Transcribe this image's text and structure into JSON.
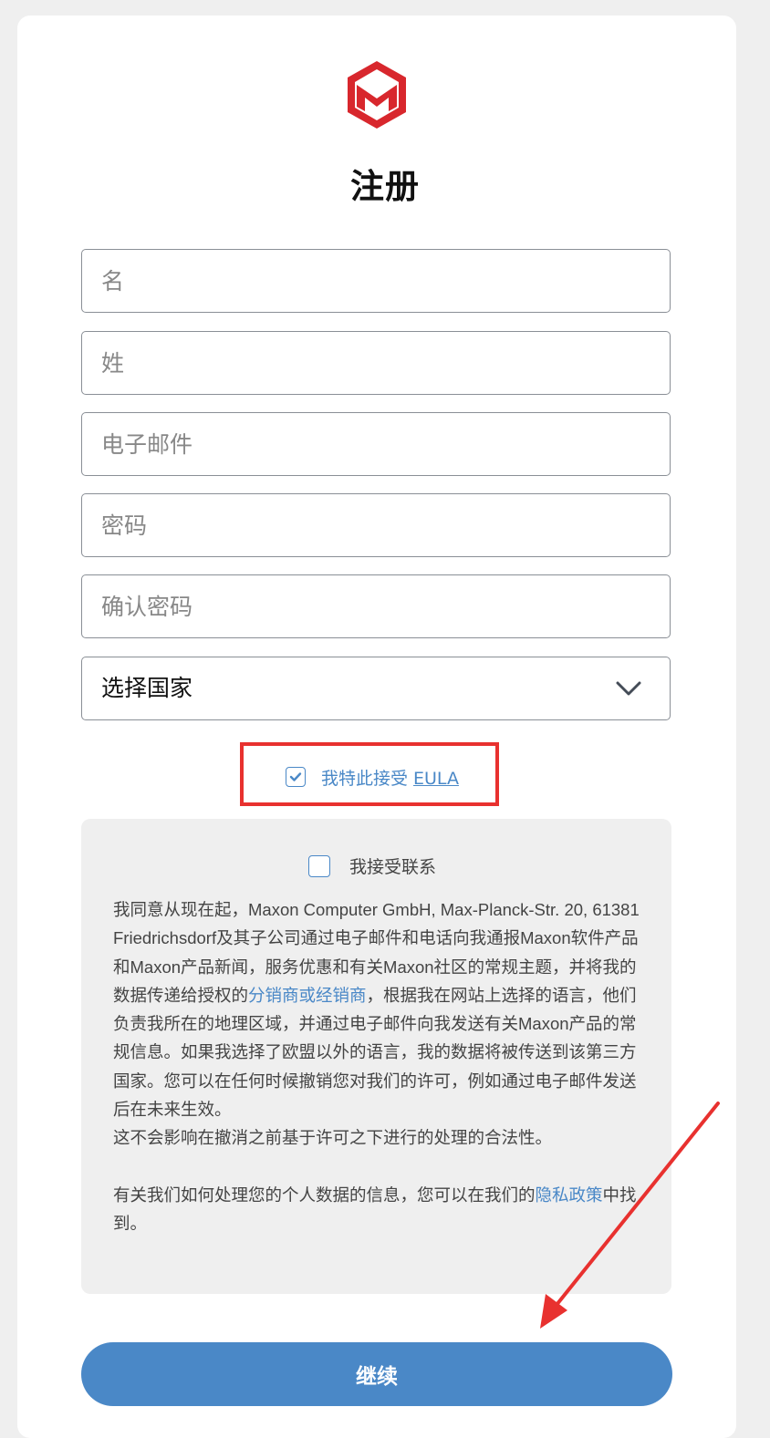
{
  "page": {
    "title": "注册"
  },
  "form": {
    "first_name_placeholder": "名",
    "last_name_placeholder": "姓",
    "email_placeholder": "电子邮件",
    "password_placeholder": "密码",
    "confirm_password_placeholder": "确认密码",
    "country_select_value": "选择国家"
  },
  "eula": {
    "checked": true,
    "label": "我特此接受",
    "link_text": "EULA"
  },
  "consent": {
    "checked": false,
    "checkbox_label": "我接受联系",
    "text_part1": "我同意从现在起，Maxon Computer GmbH, Max-Planck-Str. 20, 61381 Friedrichsdorf及其子公司通过电子邮件和电话向我通报Maxon软件产品和Maxon产品新闻，服务优惠和有关Maxon社区的常规主题，并将我的数据传递给授权的",
    "link_distributors": "分销商或经销商",
    "text_part2": "，根据我在网站上选择的语言，他们负责我所在的地理区域，并通过电子邮件向我发送有关Maxon产品的常规信息。如果我选择了欧盟以外的语言，我的数据将被传送到该第三方国家。您可以在任何时候撤销您对我们的许可，例如通过电子邮件发送后在未来生效。",
    "text_part3": "这不会影响在撤消之前基于许可之下进行的处理的合法性。",
    "privacy_prefix": "有关我们如何处理您的个人数据的信息，您可以在我们的",
    "privacy_link": "隐私政策",
    "privacy_suffix": "中找到。"
  },
  "actions": {
    "continue_label": "继续"
  },
  "colors": {
    "accent": "#4a88c7",
    "brand_red": "#d8272d",
    "highlight_red": "#e8312f",
    "panel_bg": "#efefef"
  },
  "icons": [
    "maxon-logo",
    "chevron-down-icon",
    "checkbox-checked-icon",
    "checkbox-empty-icon",
    "annotation-arrow"
  ]
}
